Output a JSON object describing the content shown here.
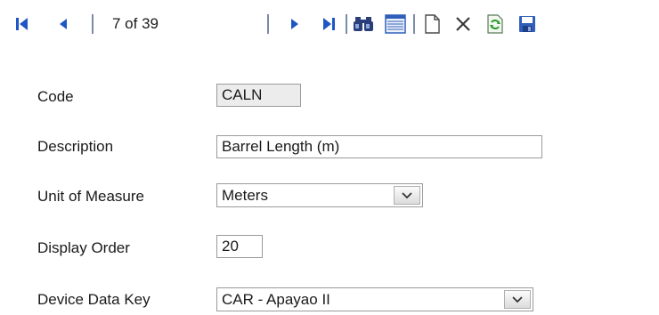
{
  "navigator": {
    "record_position": "7 of 39"
  },
  "form": {
    "code": {
      "label": "Code",
      "value": "CALN"
    },
    "description": {
      "label": "Description",
      "value": "Barrel Length (m)"
    },
    "unit_of_measure": {
      "label": "Unit of Measure",
      "value": "Meters"
    },
    "display_order": {
      "label": "Display Order",
      "value": "20"
    },
    "device_data_key": {
      "label": "Device Data Key",
      "value": "CAR - Apayao II"
    }
  },
  "colors": {
    "nav_blue": "#1f56c4",
    "save_blue": "#2f5fb8",
    "refresh_green": "#2e9a2e"
  },
  "icons": [
    "first-record-icon",
    "previous-record-icon",
    "next-record-icon",
    "last-record-icon",
    "find-icon",
    "list-view-icon",
    "new-record-icon",
    "delete-icon",
    "refresh-icon",
    "save-icon"
  ]
}
